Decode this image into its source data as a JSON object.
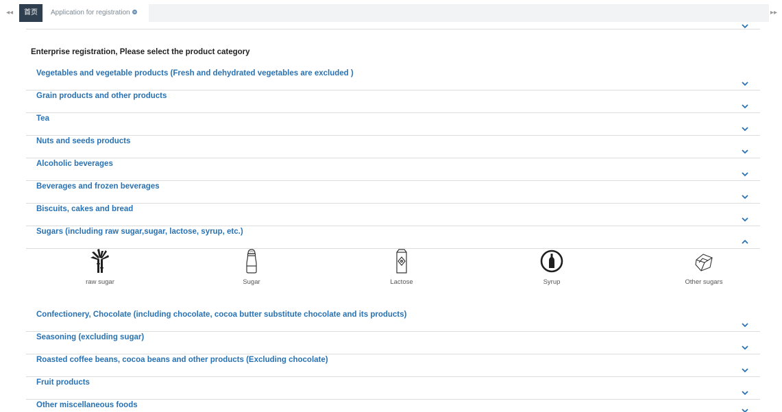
{
  "tabs": {
    "home_label": "首页",
    "registration_label": "Application for registration",
    "scroll_left": "◂◂",
    "scroll_right": "▸▸"
  },
  "page": {
    "heading": "Enterprise registration, Please select the product category"
  },
  "categories": [
    {
      "label": "Vegetables and vegetable products  (Fresh and dehydrated vegetables are excluded )",
      "expanded": false
    },
    {
      "label": "Grain products and other products",
      "expanded": false
    },
    {
      "label": "Tea",
      "expanded": false
    },
    {
      "label": "Nuts and seeds products",
      "expanded": false
    },
    {
      "label": "Alcoholic beverages",
      "expanded": false
    },
    {
      "label": "Beverages and frozen beverages",
      "expanded": false
    },
    {
      "label": "Biscuits, cakes and bread",
      "expanded": false
    },
    {
      "label": "Sugars (including raw sugar,sugar, lactose, syrup, etc.)",
      "expanded": true
    },
    {
      "label": "Confectionery, Chocolate (including chocolate, cocoa butter substitute chocolate and its products)",
      "expanded": false
    },
    {
      "label": "Seasoning (excluding sugar)",
      "expanded": false
    },
    {
      "label": "Roasted coffee beans, cocoa beans and other products (Excluding chocolate)",
      "expanded": false
    },
    {
      "label": "Fruit products",
      "expanded": false
    },
    {
      "label": "Other miscellaneous foods",
      "expanded": false
    }
  ],
  "sugar_subcategories": [
    {
      "label": "raw sugar",
      "icon": "sugarcane-icon"
    },
    {
      "label": "Sugar",
      "icon": "sugar-shaker-icon"
    },
    {
      "label": "Lactose",
      "icon": "milk-carton-icon"
    },
    {
      "label": "Syrup",
      "icon": "syrup-bottle-icon"
    },
    {
      "label": "Other sugars",
      "icon": "sugar-cube-icon"
    }
  ],
  "colors": {
    "link": "#2872b3",
    "tab_active_bg": "#2f3f4f",
    "tab_strip_bg": "#f1f3f4",
    "divider": "#dcdcdc",
    "chevron": "#2872b3"
  }
}
